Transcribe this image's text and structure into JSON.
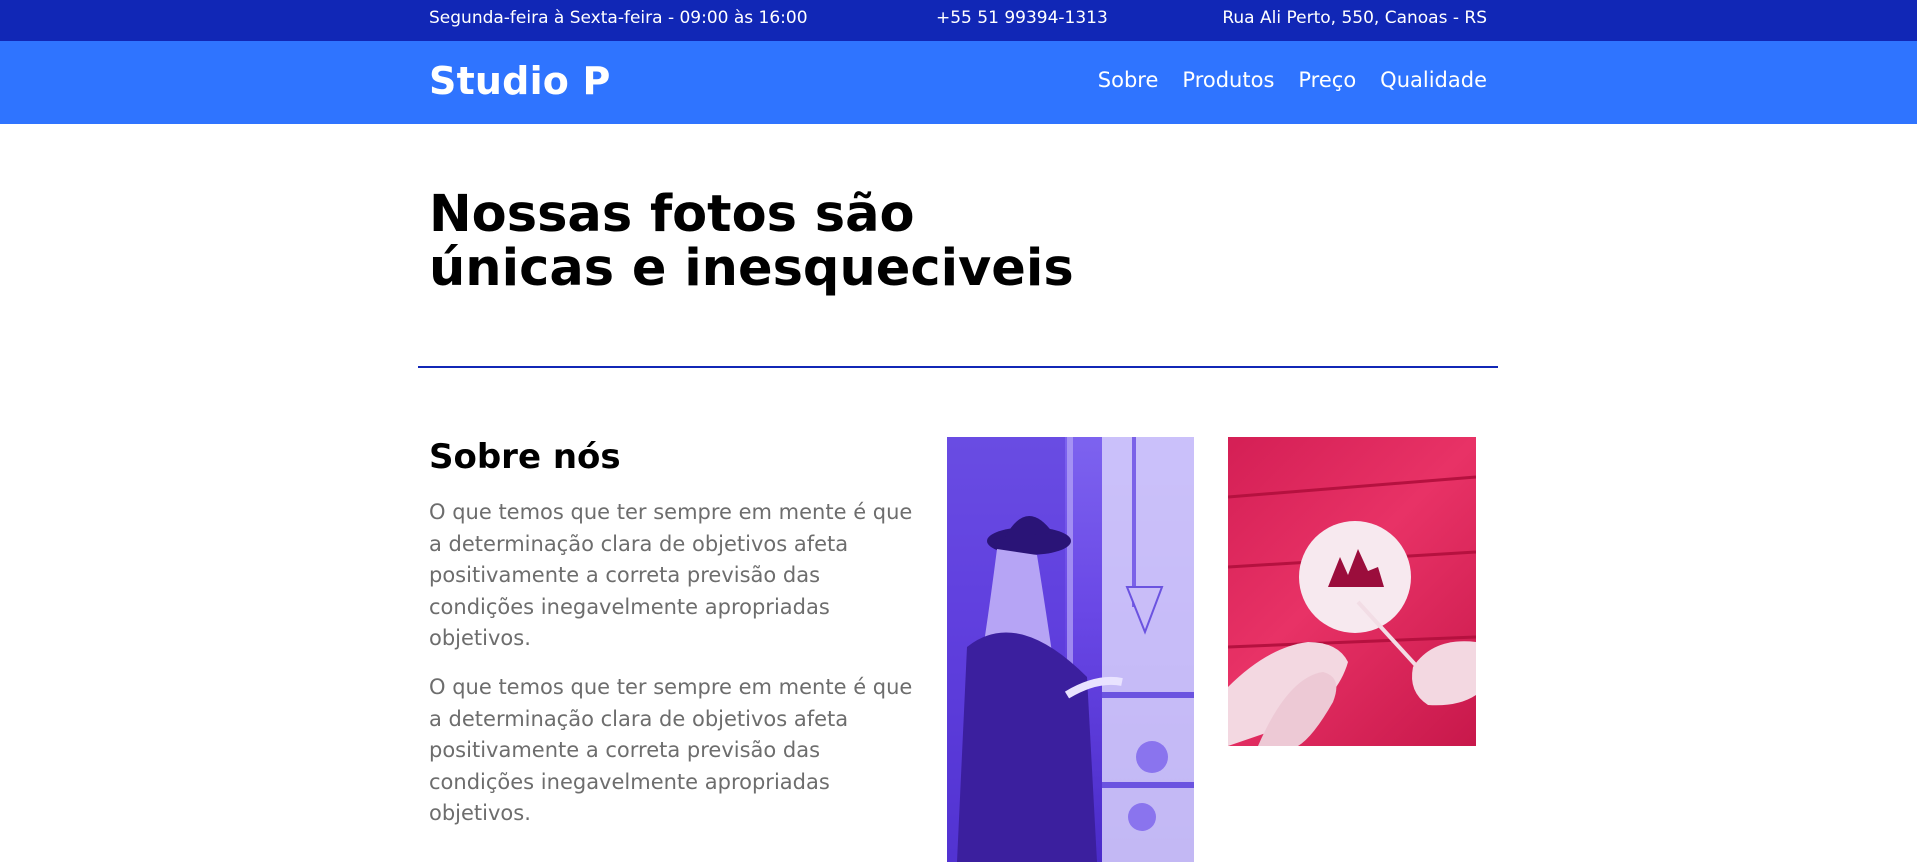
{
  "topbar": {
    "hours": "Segunda-feira à Sexta-feira - 09:00 às 16:00",
    "phone": "+55 51 99394-1313",
    "address": "Rua Ali Perto, 550, Canoas - RS"
  },
  "header": {
    "brand": "Studio P",
    "nav": [
      "Sobre",
      "Produtos",
      "Preço",
      "Qualidade"
    ]
  },
  "hero": {
    "title_line1": "Nossas fotos são",
    "title_line2": "únicas e inesqueciveis"
  },
  "about": {
    "title": "Sobre nós",
    "paragraphs": [
      "O que temos que ter sempre em mente é que a determinação clara de objetivos afeta positivamente a correta previsão das condições inegavelmente apropriadas objetivos.",
      "O que temos que ter sempre em mente é que a determinação clara de objetivos afeta positivamente a correta previsão das condições inegavelmente apropriadas objetivos."
    ]
  },
  "colors": {
    "topbar": "#1127b6",
    "navbar": "#2f74ff",
    "divider": "#1127b6",
    "body_text": "#6d6d6d"
  }
}
